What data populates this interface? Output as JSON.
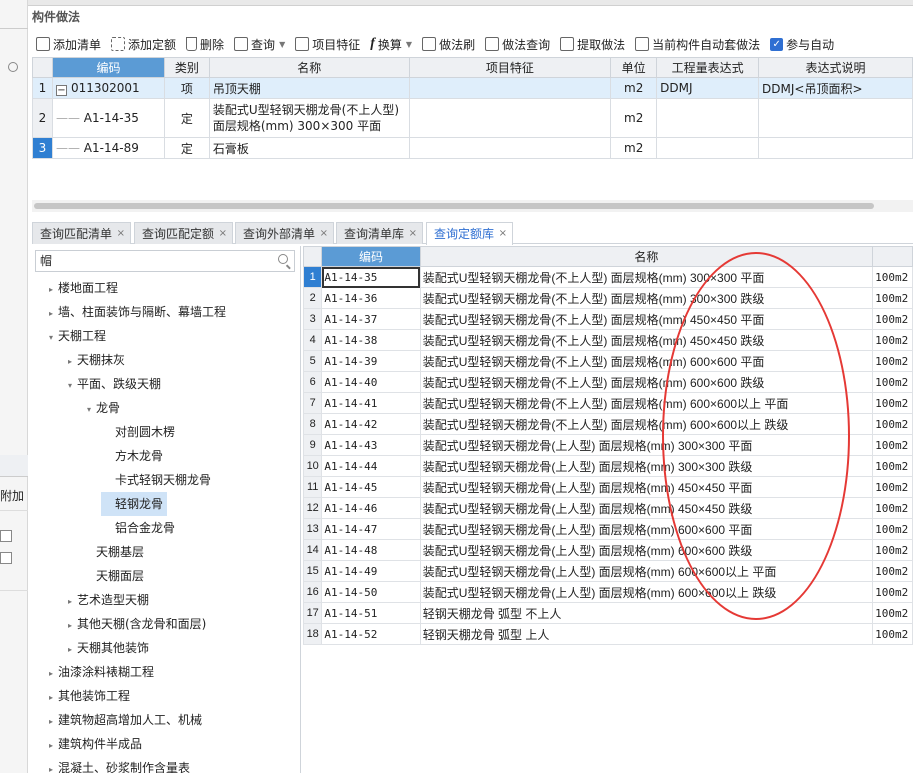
{
  "panel": {
    "title": "构件做法"
  },
  "toolbar": {
    "add_bill": "添加清单",
    "add_quota": "添加定额",
    "delete": "删除",
    "query": "查询",
    "item_feature": "项目特征",
    "convert": "换算",
    "method_brush": "做法刷",
    "method_query": "做法查询",
    "extract_method": "提取做法",
    "auto_apply": "当前构件自动套做法",
    "participate_auto": "参与自动",
    "participate_checked": true
  },
  "top_grid": {
    "headers": [
      "编码",
      "类别",
      "名称",
      "项目特征",
      "单位",
      "工程量表达式",
      "表达式说明"
    ],
    "rows": [
      {
        "n": "1",
        "code": "011302001",
        "type": "项",
        "name": "吊顶天棚",
        "name2": "",
        "feature": "",
        "unit": "m2",
        "expr": "DDMJ",
        "desc": "DDMJ<吊顶面积>"
      },
      {
        "n": "2",
        "code": "A1-14-35",
        "type": "定",
        "name": "装配式U型轻钢天棚龙骨(不上人型)",
        "name2": "面层规格(mm) 300×300 平面",
        "feature": "",
        "unit": "m2",
        "expr": "",
        "desc": ""
      },
      {
        "n": "3",
        "code": "A1-14-89",
        "type": "定",
        "name": "石膏板",
        "name2": "",
        "feature": "",
        "unit": "m2",
        "expr": "",
        "desc": ""
      }
    ]
  },
  "tabs": [
    "查询匹配清单",
    "查询匹配定额",
    "查询外部清单",
    "查询清单库",
    "查询定额库"
  ],
  "search": {
    "value": "帽"
  },
  "tree": [
    {
      "label": "楼地面工程",
      "level": 0,
      "caret": "▸"
    },
    {
      "label": "墙、柱面装饰与隔断、幕墙工程",
      "level": 0,
      "caret": "▸"
    },
    {
      "label": "天棚工程",
      "level": 0,
      "caret": "▾"
    },
    {
      "label": "天棚抹灰",
      "level": 1,
      "caret": "▸"
    },
    {
      "label": "平面、跌级天棚",
      "level": 1,
      "caret": "▾"
    },
    {
      "label": "龙骨",
      "level": 2,
      "caret": "▾"
    },
    {
      "label": "对剖圆木楞",
      "level": 3,
      "caret": ""
    },
    {
      "label": "方木龙骨",
      "level": 3,
      "caret": ""
    },
    {
      "label": "卡式轻钢天棚龙骨",
      "level": 3,
      "caret": ""
    },
    {
      "label": "轻钢龙骨",
      "level": 3,
      "caret": "",
      "selected": true
    },
    {
      "label": "铝合金龙骨",
      "level": 3,
      "caret": ""
    },
    {
      "label": "天棚基层",
      "level": 2,
      "caret": ""
    },
    {
      "label": "天棚面层",
      "level": 2,
      "caret": ""
    },
    {
      "label": "艺术造型天棚",
      "level": 1,
      "caret": "▸"
    },
    {
      "label": "其他天棚(含龙骨和面层)",
      "level": 1,
      "caret": "▸"
    },
    {
      "label": "天棚其他装饰",
      "level": 1,
      "caret": "▸"
    },
    {
      "label": "油漆涂料裱糊工程",
      "level": 0,
      "caret": "▸"
    },
    {
      "label": "其他装饰工程",
      "level": 0,
      "caret": "▸"
    },
    {
      "label": "建筑物超高增加人工、机械",
      "level": 0,
      "caret": "▸"
    },
    {
      "label": "建筑构件半成品",
      "level": 0,
      "caret": "▸"
    },
    {
      "label": "混凝土、砂浆制作含量表",
      "level": 0,
      "caret": "▸"
    }
  ],
  "bottom_grid": {
    "headers": [
      "编码",
      "名称",
      ""
    ],
    "rows": [
      {
        "n": "1",
        "code": "A1-14-35",
        "name": "装配式U型轻钢天棚龙骨(不上人型) 面层规格(mm) 300×300 平面",
        "unit": "100m2"
      },
      {
        "n": "2",
        "code": "A1-14-36",
        "name": "装配式U型轻钢天棚龙骨(不上人型) 面层规格(mm) 300×300 跌级",
        "unit": "100m2"
      },
      {
        "n": "3",
        "code": "A1-14-37",
        "name": "装配式U型轻钢天棚龙骨(不上人型) 面层规格(mm) 450×450 平面",
        "unit": "100m2"
      },
      {
        "n": "4",
        "code": "A1-14-38",
        "name": "装配式U型轻钢天棚龙骨(不上人型) 面层规格(mm) 450×450 跌级",
        "unit": "100m2"
      },
      {
        "n": "5",
        "code": "A1-14-39",
        "name": "装配式U型轻钢天棚龙骨(不上人型) 面层规格(mm) 600×600 平面",
        "unit": "100m2"
      },
      {
        "n": "6",
        "code": "A1-14-40",
        "name": "装配式U型轻钢天棚龙骨(不上人型) 面层规格(mm) 600×600 跌级",
        "unit": "100m2"
      },
      {
        "n": "7",
        "code": "A1-14-41",
        "name": "装配式U型轻钢天棚龙骨(不上人型) 面层规格(mm) 600×600以上 平面",
        "unit": "100m2"
      },
      {
        "n": "8",
        "code": "A1-14-42",
        "name": "装配式U型轻钢天棚龙骨(不上人型) 面层规格(mm) 600×600以上 跌级",
        "unit": "100m2"
      },
      {
        "n": "9",
        "code": "A1-14-43",
        "name": "装配式U型轻钢天棚龙骨(上人型) 面层规格(mm) 300×300 平面",
        "unit": "100m2"
      },
      {
        "n": "10",
        "code": "A1-14-44",
        "name": "装配式U型轻钢天棚龙骨(上人型) 面层规格(mm) 300×300 跌级",
        "unit": "100m2"
      },
      {
        "n": "11",
        "code": "A1-14-45",
        "name": "装配式U型轻钢天棚龙骨(上人型) 面层规格(mm) 450×450 平面",
        "unit": "100m2"
      },
      {
        "n": "12",
        "code": "A1-14-46",
        "name": "装配式U型轻钢天棚龙骨(上人型) 面层规格(mm) 450×450 跌级",
        "unit": "100m2"
      },
      {
        "n": "13",
        "code": "A1-14-47",
        "name": "装配式U型轻钢天棚龙骨(上人型) 面层规格(mm) 600×600 平面",
        "unit": "100m2"
      },
      {
        "n": "14",
        "code": "A1-14-48",
        "name": "装配式U型轻钢天棚龙骨(上人型) 面层规格(mm) 600×600 跌级",
        "unit": "100m2"
      },
      {
        "n": "15",
        "code": "A1-14-49",
        "name": "装配式U型轻钢天棚龙骨(上人型) 面层规格(mm) 600×600以上 平面",
        "unit": "100m2"
      },
      {
        "n": "16",
        "code": "A1-14-50",
        "name": "装配式U型轻钢天棚龙骨(上人型) 面层规格(mm) 600×600以上 跌级",
        "unit": "100m2"
      },
      {
        "n": "17",
        "code": "A1-14-51",
        "name": "轻钢天棚龙骨 弧型 不上人",
        "unit": "100m2"
      },
      {
        "n": "18",
        "code": "A1-14-52",
        "name": "轻钢天棚龙骨 弧型 上人",
        "unit": "100m2"
      }
    ]
  },
  "left_panel": {
    "add_label": "附加"
  },
  "colors": {
    "accent": "#2f6fd2",
    "header_selected": "#5b9bd5",
    "annotation": "#e53935"
  }
}
